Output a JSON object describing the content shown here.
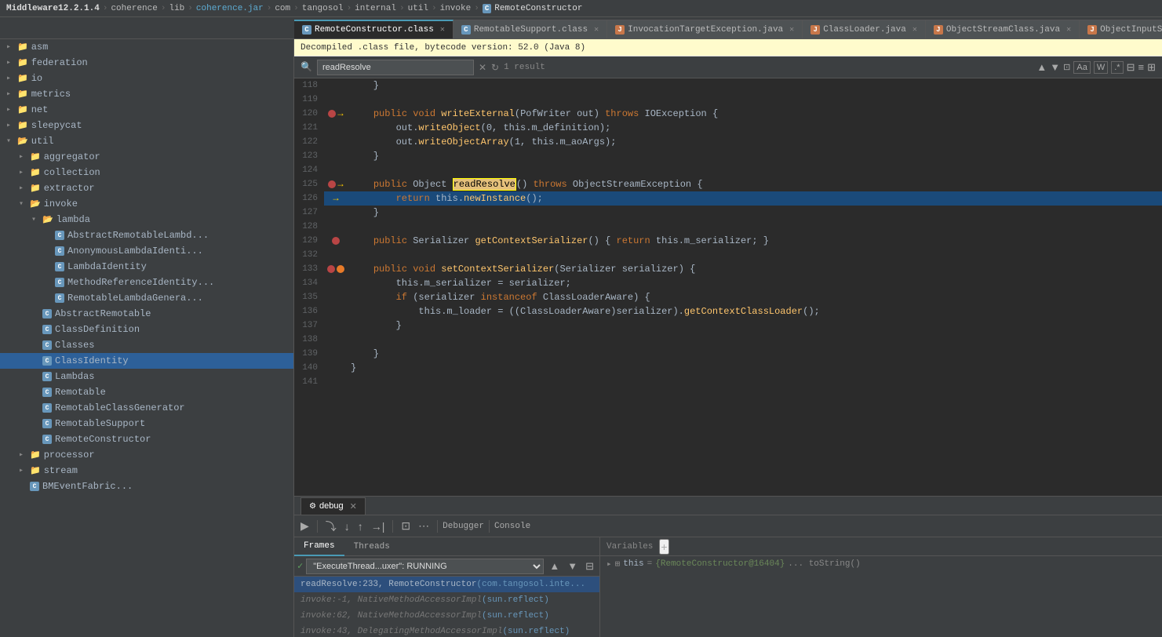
{
  "titlebar": {
    "parts": [
      "Middleware12.2.1.4",
      "coherence",
      "lib",
      "coherence.jar",
      "com",
      "tangosol",
      "internal",
      "util",
      "invoke",
      "RemoteConstructor"
    ]
  },
  "tabs": [
    {
      "id": "remote-constructor-class",
      "label": "RemoteConstructor.class",
      "icon": "c",
      "active": true
    },
    {
      "id": "remotable-support-class",
      "label": "RemotableSupport.class",
      "icon": "c",
      "active": false
    },
    {
      "id": "invocation-target-exception",
      "label": "InvocationTargetException.java",
      "icon": "j",
      "active": false
    },
    {
      "id": "class-loader-java",
      "label": "ClassLoader.java",
      "icon": "j",
      "active": false
    },
    {
      "id": "object-stream-class-java",
      "label": "ObjectStreamClass.java",
      "icon": "j",
      "active": false
    },
    {
      "id": "object-input-stream-java",
      "label": "ObjectInputStream.ja...",
      "icon": "j",
      "active": false
    }
  ],
  "infobar": {
    "text": "Decompiled .class file, bytecode version: 52.0 (Java 8)"
  },
  "search": {
    "value": "readResolve",
    "placeholder": "Search",
    "result_count": "1 result"
  },
  "sidebar": {
    "items": [
      {
        "level": 1,
        "type": "folder",
        "label": "asm",
        "expanded": false
      },
      {
        "level": 1,
        "type": "folder",
        "label": "federation",
        "expanded": false
      },
      {
        "level": 1,
        "type": "folder",
        "label": "io",
        "expanded": false
      },
      {
        "level": 1,
        "type": "folder",
        "label": "metrics",
        "expanded": false
      },
      {
        "level": 1,
        "type": "folder",
        "label": "net",
        "expanded": false
      },
      {
        "level": 1,
        "type": "folder",
        "label": "sleepycat",
        "expanded": false
      },
      {
        "level": 1,
        "type": "folder",
        "label": "util",
        "expanded": true
      },
      {
        "level": 2,
        "type": "folder",
        "label": "aggregator",
        "expanded": false
      },
      {
        "level": 2,
        "type": "folder",
        "label": "collection",
        "expanded": false
      },
      {
        "level": 2,
        "type": "folder",
        "label": "extractor",
        "expanded": false
      },
      {
        "level": 2,
        "type": "folder",
        "label": "invoke",
        "expanded": true
      },
      {
        "level": 3,
        "type": "folder",
        "label": "lambda",
        "expanded": true
      },
      {
        "level": 4,
        "type": "class",
        "label": "AbstractRemotableLambd..."
      },
      {
        "level": 4,
        "type": "class",
        "label": "AnonymousLambdaIdenti..."
      },
      {
        "level": 4,
        "type": "class",
        "label": "LambdaIdentity"
      },
      {
        "level": 4,
        "type": "class",
        "label": "MethodReferenceIdentity..."
      },
      {
        "level": 4,
        "type": "class",
        "label": "RemotableLambdaGenera..."
      },
      {
        "level": 3,
        "type": "class",
        "label": "AbstractRemotable"
      },
      {
        "level": 3,
        "type": "class",
        "label": "ClassDefinition"
      },
      {
        "level": 3,
        "type": "class",
        "label": "Classes"
      },
      {
        "level": 3,
        "type": "class",
        "label": "ClassIdentity",
        "selected": true,
        "highlighted": true
      },
      {
        "level": 3,
        "type": "class",
        "label": "Lambdas"
      },
      {
        "level": 3,
        "type": "class",
        "label": "Remotable"
      },
      {
        "level": 3,
        "type": "class",
        "label": "RemotableClassGenerator"
      },
      {
        "level": 3,
        "type": "class",
        "label": "RemotableSupport"
      },
      {
        "level": 3,
        "type": "class",
        "label": "RemoteConstructor"
      },
      {
        "level": 2,
        "type": "folder",
        "label": "processor",
        "expanded": false
      },
      {
        "level": 2,
        "type": "folder",
        "label": "stream",
        "expanded": false
      },
      {
        "level": 2,
        "type": "class",
        "label": "BMEventFabric..."
      }
    ]
  },
  "code": {
    "lines": [
      {
        "num": "118",
        "gutter": "",
        "content": "    }",
        "highlighted": false
      },
      {
        "num": "119",
        "gutter": "",
        "content": "",
        "highlighted": false
      },
      {
        "num": "120",
        "gutter": "bp+arrow",
        "content": "    public void writeExternal(PofWriter out) throws IOException {",
        "highlighted": false
      },
      {
        "num": "121",
        "gutter": "",
        "content": "        out.writeObject(0, this.m_definition);",
        "highlighted": false
      },
      {
        "num": "122",
        "gutter": "",
        "content": "        out.writeObjectArray(1, this.m_aoArgs);",
        "highlighted": false
      },
      {
        "num": "123",
        "gutter": "",
        "content": "    }",
        "highlighted": false
      },
      {
        "num": "124",
        "gutter": "",
        "content": "",
        "highlighted": false
      },
      {
        "num": "125",
        "gutter": "bp+arrow2",
        "content": "    public Object readResolve() throws ObjectStreamException {",
        "highlighted": false
      },
      {
        "num": "126",
        "gutter": "arrow3",
        "content": "        return this.newInstance();",
        "highlighted": true
      },
      {
        "num": "127",
        "gutter": "",
        "content": "    }",
        "highlighted": false
      },
      {
        "num": "128",
        "gutter": "",
        "content": "",
        "highlighted": false
      },
      {
        "num": "129",
        "gutter": "bp2",
        "content": "    public Serializer getContextSerializer() { return this.m_serializer; }",
        "highlighted": false
      },
      {
        "num": "132",
        "gutter": "",
        "content": "",
        "highlighted": false
      },
      {
        "num": "133",
        "gutter": "bp3+orange",
        "content": "    public void setContextSerializer(Serializer serializer) {",
        "highlighted": false
      },
      {
        "num": "134",
        "gutter": "",
        "content": "        this.m_serializer = serializer;",
        "highlighted": false
      },
      {
        "num": "135",
        "gutter": "",
        "content": "        if (serializer instanceof ClassLoaderAware) {",
        "highlighted": false
      },
      {
        "num": "136",
        "gutter": "",
        "content": "            this.m_loader = ((ClassLoaderAware)serializer).getContextClassLoader();",
        "highlighted": false
      },
      {
        "num": "137",
        "gutter": "",
        "content": "        }",
        "highlighted": false
      },
      {
        "num": "138",
        "gutter": "",
        "content": "",
        "highlighted": false
      },
      {
        "num": "139",
        "gutter": "",
        "content": "    }",
        "highlighted": false
      },
      {
        "num": "140",
        "gutter": "",
        "content": "}",
        "highlighted": false
      },
      {
        "num": "141",
        "gutter": "",
        "content": "",
        "highlighted": false
      }
    ]
  },
  "debug": {
    "tab_label": "debug",
    "toolbar": {
      "buttons": [
        "resume",
        "step-over",
        "step-into",
        "step-out",
        "run-to-cursor",
        "evaluate",
        "more"
      ]
    },
    "subtabs": {
      "debugger_label": "Debugger",
      "console_label": "Console"
    },
    "frames_tab": "Frames",
    "threads_tab": "Threads",
    "thread_value": "\"ExecuteThread...uxer\": RUNNING",
    "frames": [
      {
        "label": "readResolve:233, RemoteConstructor",
        "package": "(com.tangosol.inte...",
        "selected": true
      },
      {
        "label": "invoke:-1, NativeMethodAccessorImpl",
        "package": "(sun.reflect)",
        "selected": false
      },
      {
        "label": "invoke:62, NativeMethodAccessorImpl",
        "package": "(sun.reflect)",
        "selected": false
      },
      {
        "label": "invoke:43, DelegatingMethodAccessorImpl",
        "package": "(sun.reflect)",
        "selected": false
      }
    ],
    "variables_label": "Variables",
    "variables": [
      {
        "name": "this",
        "value": "{RemoteConstructor@16404}",
        "extra": "... toString()"
      }
    ]
  }
}
